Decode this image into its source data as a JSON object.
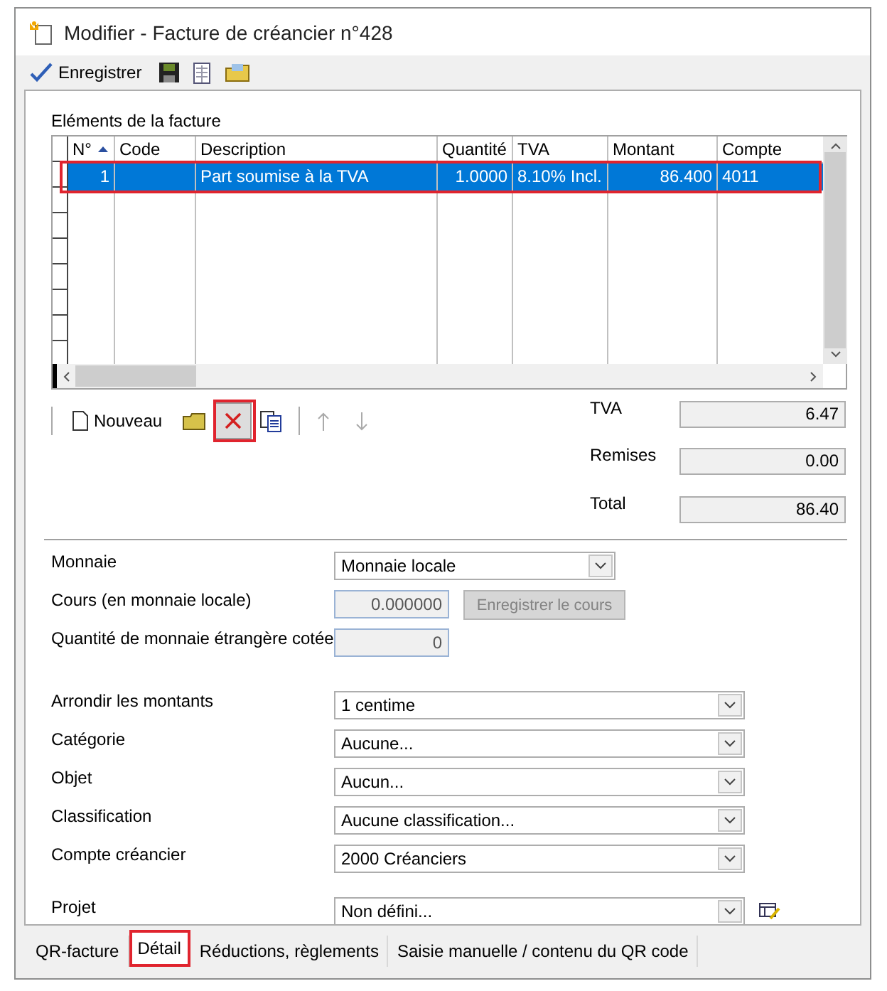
{
  "window": {
    "title": "Modifier - Facture de créancier n°428"
  },
  "toolbar": {
    "save_label": "Enregistrer"
  },
  "items": {
    "title": "Eléments de la facture",
    "columns": [
      {
        "label": "N°",
        "sorted": true
      },
      {
        "label": "Code",
        "sorted": false
      },
      {
        "label": "Description",
        "sorted": false
      },
      {
        "label": "Quantité",
        "sorted": false
      },
      {
        "label": "TVA",
        "sorted": false
      },
      {
        "label": "Montant",
        "sorted": false
      },
      {
        "label": "Compte",
        "sorted": false
      }
    ],
    "rows": [
      {
        "cells": [
          "1",
          "",
          "Part soumise à la TVA",
          "1.0000",
          "8.10% Incl.",
          "86.400",
          "4011"
        ],
        "selected": true,
        "highlighted": true
      }
    ]
  },
  "item_toolbar": {
    "new_label": "Nouveau",
    "delete_highlighted": true
  },
  "totals": [
    {
      "label": "TVA",
      "value": "6.47"
    },
    {
      "label": "Remises",
      "value": "0.00"
    },
    {
      "label": "Total",
      "value": "86.40"
    }
  ],
  "currency": {
    "label": "Monnaie",
    "value": "Monnaie locale",
    "rate_label": "Cours (en monnaie locale)",
    "rate_value": "0.000000",
    "rate_button": "Enregistrer le cours",
    "qty_label": "Quantité de monnaie étrangère cotée",
    "qty_value": "0"
  },
  "fields": [
    {
      "label": "Arrondir les montants",
      "value": "1 centime"
    },
    {
      "label": "Catégorie",
      "value": "Aucune..."
    },
    {
      "label": "Objet",
      "value": "Aucun..."
    },
    {
      "label": "Classification",
      "value": "Aucune classification..."
    },
    {
      "label": "Compte créancier",
      "value": "2000 Créanciers"
    },
    {
      "label": "Projet",
      "value": "Non défini...",
      "has_action": true
    }
  ],
  "tabs": [
    {
      "label": "QR-facture",
      "selected": false,
      "highlighted": false
    },
    {
      "label": "Détail",
      "selected": true,
      "highlighted": true
    },
    {
      "label": "Réductions, règlements",
      "selected": false,
      "highlighted": false
    },
    {
      "label": "Saisie manuelle / contenu du QR code",
      "selected": false,
      "highlighted": false
    }
  ]
}
